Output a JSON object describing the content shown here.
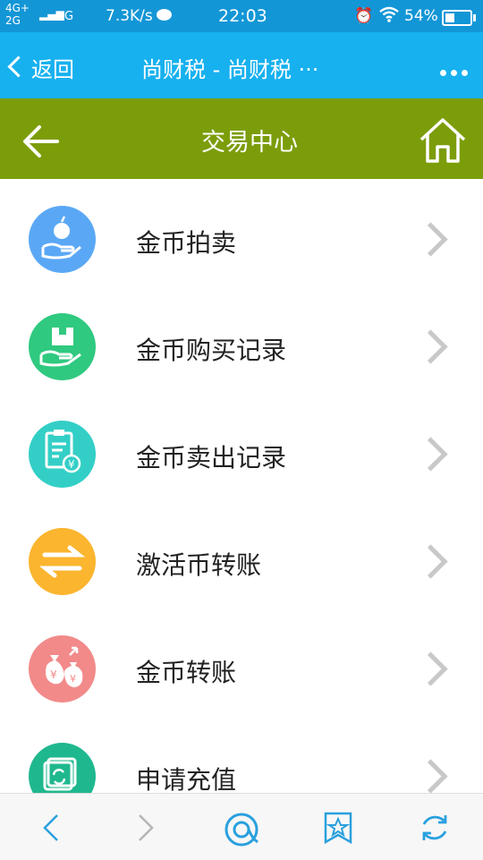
{
  "status_bar": {
    "network": "4G+",
    "network2": "2G",
    "carrier": "G",
    "speed": "7.3K/s",
    "time": "22:03",
    "battery": "54%"
  },
  "browser": {
    "back_label": "返回",
    "title": "尚财税 - 尚财税 ···"
  },
  "header": {
    "title": "交易中心"
  },
  "menu": [
    {
      "label": "金币拍卖",
      "icon": "hand-apple-icon",
      "color": "#5aa8f5"
    },
    {
      "label": "金币购买记录",
      "icon": "hand-box-icon",
      "color": "#2fc97f"
    },
    {
      "label": "金币卖出记录",
      "icon": "document-yen-icon",
      "color": "#33cfc6"
    },
    {
      "label": "激活币转账",
      "icon": "transfer-arrows-icon",
      "color": "#fbb52f"
    },
    {
      "label": "金币转账",
      "icon": "money-bag-icon",
      "color": "#f28a8a"
    },
    {
      "label": "申请充值",
      "icon": "refresh-card-icon",
      "color": "#1fb88e"
    }
  ],
  "colors": {
    "status_bar": "#1396d6",
    "browser_bar": "#17b1ef",
    "header": "#7c9d0a",
    "toolbar_icon": "#2aa0de"
  }
}
